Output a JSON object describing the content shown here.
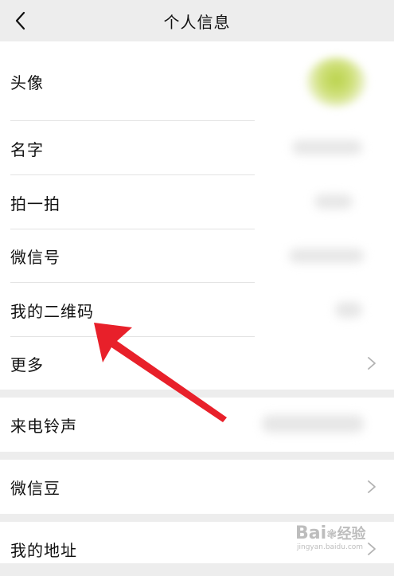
{
  "nav": {
    "title": "个人信息",
    "back_icon": "chevron-left-icon"
  },
  "profile_group": {
    "avatar_label": "头像",
    "name_label": "名字",
    "pat_label": "拍一拍",
    "wechat_id_label": "微信号",
    "qr_code_label": "我的二维码",
    "more_label": "更多"
  },
  "ringtone_group": {
    "ringtone_label": "来电铃声"
  },
  "beans_group": {
    "beans_label": "微信豆"
  },
  "address_group": {
    "address_label": "我的地址"
  },
  "watermark": {
    "main": "Bai",
    "paw": "du",
    "brand": "经验",
    "sub": "jingyan.baidu.com"
  },
  "colors": {
    "background": "#ededed",
    "row": "#ffffff",
    "divider": "#e3e3e3",
    "arrow": "#e8202a",
    "text": "#111111"
  }
}
